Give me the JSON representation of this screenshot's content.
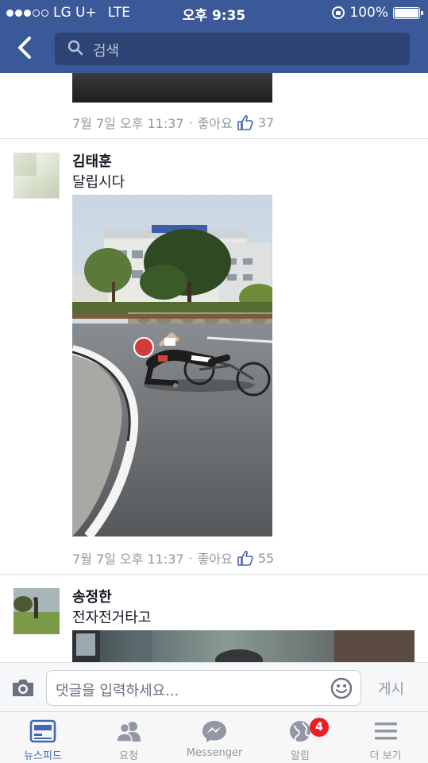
{
  "status_bar": {
    "carrier": "LG U+",
    "network": "LTE",
    "time": "오후 9:35",
    "battery": "100%"
  },
  "header": {
    "search_placeholder": "검색",
    "back_icon": "chevron-left-icon",
    "search_icon": "search-icon"
  },
  "feed": {
    "posts": [
      {
        "timestamp": "7월 7일 오후 11:37",
        "like_label": "좋아요",
        "like_count": "37"
      },
      {
        "author": "김태훈",
        "text": "달립시다",
        "timestamp": "7월 7일 오후 11:37",
        "like_label": "좋아요",
        "like_count": "55"
      },
      {
        "author": "송정한",
        "text": "전자전거타고"
      }
    ],
    "separator": "·"
  },
  "comment_bar": {
    "placeholder": "댓글을 입력하세요...",
    "post_label": "게시",
    "camera_icon": "camera-icon",
    "emoji_icon": "smiley-icon"
  },
  "tabs": [
    {
      "label": "뉴스피드",
      "icon": "news-feed-icon",
      "active": true
    },
    {
      "label": "요청",
      "icon": "friend-requests-icon"
    },
    {
      "label": "Messenger",
      "icon": "messenger-icon"
    },
    {
      "label": "알림",
      "icon": "globe-icon",
      "badge": "4"
    },
    {
      "label": "더 보기",
      "icon": "menu-icon"
    }
  ],
  "colors": {
    "brand": "#3b5998",
    "active_tab": "#4267b2",
    "badge": "#ee1d24"
  }
}
